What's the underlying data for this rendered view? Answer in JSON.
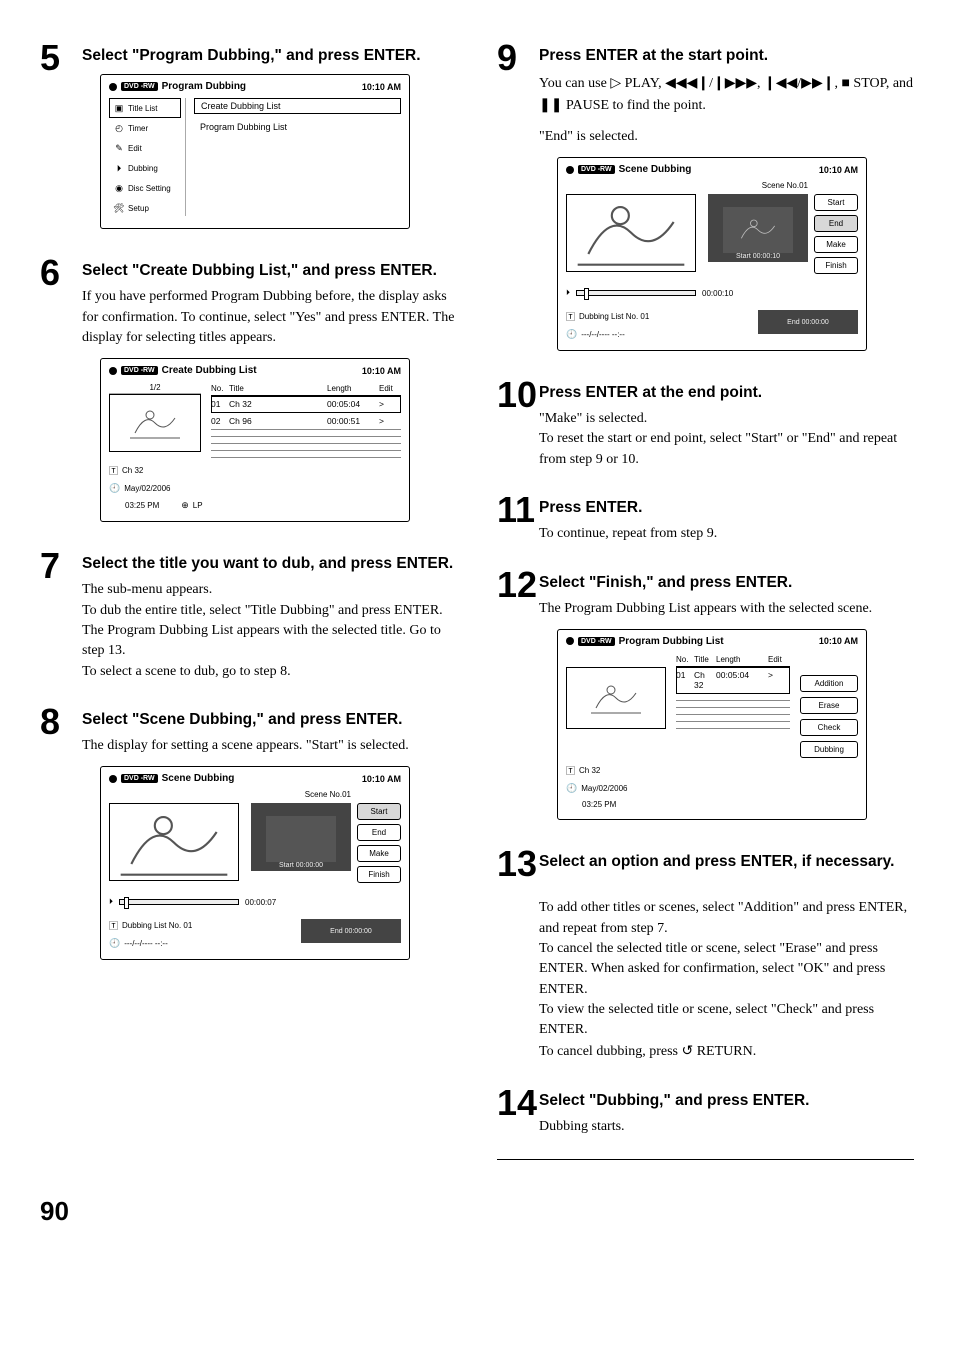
{
  "steps": {
    "s5": {
      "num": "5",
      "title": "Select \"Program Dubbing,\" and press ENTER.",
      "panel": {
        "badge": "DVD -RW",
        "title": "Program Dubbing",
        "time": "10:10 AM",
        "menu": [
          "Title List",
          "Timer",
          "Edit",
          "Dubbing",
          "Disc Setting",
          "Setup"
        ],
        "opt_box": "Create Dubbing List",
        "opt_plain": "Program Dubbing List"
      }
    },
    "s6": {
      "num": "6",
      "title": "Select \"Create Dubbing List,\" and press ENTER.",
      "desc": "If you have performed Program Dubbing before, the display asks for confirmation. To continue, select \"Yes\" and press ENTER. The display for selecting titles appears.",
      "panel": {
        "badge": "DVD -RW",
        "title": "Create Dubbing List",
        "time": "10:10 AM",
        "thumb_label": "1/2",
        "head": {
          "no": "No.",
          "title": "Title",
          "len": "Length",
          "edit": "Edit"
        },
        "rows": [
          {
            "no": "01",
            "title": "Ch 32",
            "len": "00:05:04",
            "edit": ">"
          },
          {
            "no": "02",
            "title": "Ch 96",
            "len": "00:00:51",
            "edit": ">"
          }
        ],
        "meta_t": "Ch 32",
        "meta_d": "May/02/2006",
        "meta_time": "03:25  PM",
        "meta_mode": "LP"
      }
    },
    "s7": {
      "num": "7",
      "title": "Select the title you want to dub, and press ENTER.",
      "desc": "The sub-menu appears.\nTo dub the entire title, select \"Title Dubbing\" and press ENTER. The Program Dubbing List appears with the selected title. Go to step 13.\nTo select a scene to dub, go to step 8."
    },
    "s8": {
      "num": "8",
      "title": "Select \"Scene Dubbing,\" and press ENTER.",
      "desc": "The display for setting a scene appears. \"Start\" is selected.",
      "panel": {
        "badge": "DVD -RW",
        "title": "Scene Dubbing",
        "time": "10:10 AM",
        "scene_no": "Scene No.01",
        "start_label": "Start  00:00:00",
        "end_label": "End    00:00:00",
        "buttons": [
          "Start",
          "End",
          "Make",
          "Finish"
        ],
        "sel_index": 0,
        "prog_head": "00:00:07",
        "dub_list": "Dubbing List No. 01",
        "dub_date": "---/--/----  --:--",
        "knob_pct": 3
      }
    },
    "s9": {
      "num": "9",
      "title": "Press ENTER at the start point.",
      "desc_pre": "You can use ",
      "desc_play": " PLAY, ",
      "desc_mid": ", ",
      "desc_stop": " STOP, and ",
      "desc_pause": " PAUSE to find the point.",
      "desc2": "\"End\" is selected.",
      "panel": {
        "badge": "DVD -RW",
        "title": "Scene Dubbing",
        "time": "10:10 AM",
        "scene_no": "Scene No.01",
        "start_label": "Start  00:00:10",
        "end_label": "End    00:00:00",
        "buttons": [
          "Start",
          "End",
          "Make",
          "Finish"
        ],
        "sel_index": 1,
        "prog_head": "00:00:10",
        "dub_list": "Dubbing List No. 01",
        "dub_date": "---/--/----  --:--",
        "knob_pct": 6
      }
    },
    "s10": {
      "num": "10",
      "title": "Press ENTER at the end point.",
      "desc": "\"Make\" is selected.\nTo reset the start or end point, select \"Start\" or \"End\" and repeat from step 9 or 10."
    },
    "s11": {
      "num": "11",
      "title": "Press ENTER.",
      "desc": "To continue, repeat from step 9."
    },
    "s12": {
      "num": "12",
      "title": "Select \"Finish,\" and press ENTER.",
      "desc": "The Program Dubbing List appears with the selected scene.",
      "panel": {
        "badge": "DVD -RW",
        "title": "Program Dubbing List",
        "time": "10:10 AM",
        "head": {
          "no": "No.",
          "title": "Title",
          "len": "Length",
          "edit": "Edit"
        },
        "rows": [
          {
            "no": "01",
            "title": "Ch 32",
            "len": "00:05:04",
            "edit": ">"
          }
        ],
        "buttons": [
          "Addition",
          "Erase",
          "Check",
          "Dubbing"
        ],
        "meta_t": "Ch 32",
        "meta_d": "May/02/2006",
        "meta_time": "03:25  PM"
      }
    },
    "s13": {
      "num": "13",
      "title": "Select an option and press ENTER, if necessary.",
      "desc": "To add other titles or scenes, select \"Addition\" and press ENTER, and repeat from step 7.\nTo cancel the selected title or scene, select \"Erase\" and press ENTER. When asked for confirmation, select \"OK\" and press ENTER.\nTo view the selected title or scene, select \"Check\" and press ENTER.\nTo cancel dubbing, press ",
      "desc_return": " RETURN."
    },
    "s14": {
      "num": "14",
      "title": "Select \"Dubbing,\" and press ENTER.",
      "desc": "Dubbing starts."
    }
  },
  "page_number": "90"
}
